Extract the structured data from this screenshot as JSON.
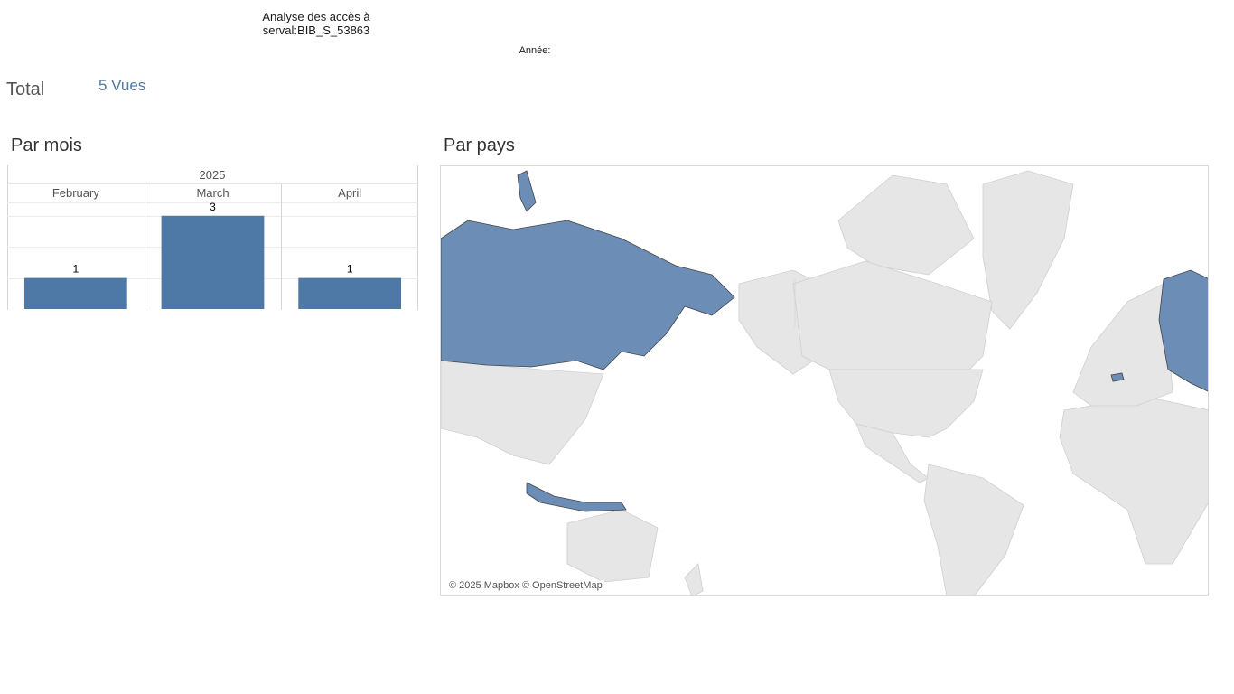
{
  "header": {
    "title_line1": "Analyse des accès à",
    "title_line2": "serval:BIB_S_53863",
    "year_filter_label": "Année:"
  },
  "summary": {
    "total_label": "Total",
    "total_value": "5 Vues"
  },
  "sections": {
    "by_month": "Par mois",
    "by_country": "Par pays"
  },
  "chart_data": {
    "type": "bar",
    "year_header": "2025",
    "categories": [
      "February",
      "March",
      "April"
    ],
    "values": [
      1,
      3,
      1
    ],
    "data_labels": [
      "1",
      "3",
      "1"
    ],
    "ylim": [
      0,
      3.4
    ],
    "grid": true,
    "bar_color": "#4e79a7"
  },
  "map": {
    "credit": "© 2025 Mapbox © OpenStreetMap",
    "highlight_color": "#6b8db6",
    "land_color": "#e6e6e6",
    "highlighted_regions": [
      "Russia",
      "Indonesia",
      "Switzerland"
    ]
  }
}
